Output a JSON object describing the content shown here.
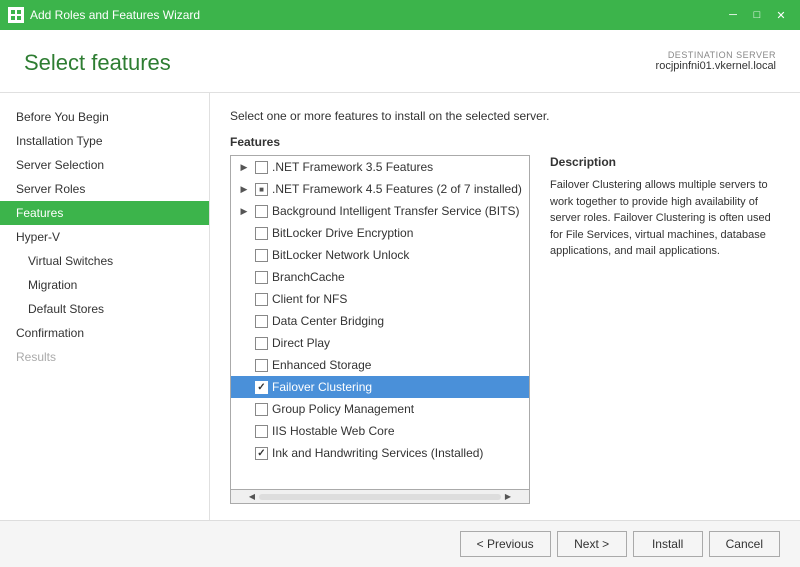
{
  "titleBar": {
    "title": "Add Roles and Features Wizard",
    "icon": "wizard-icon"
  },
  "header": {
    "pageTitle": "Select features",
    "destinationLabel": "DESTINATION SERVER",
    "serverName": "rocjpinfni01.vkernel.local"
  },
  "sidebar": {
    "items": [
      {
        "id": "before-you-begin",
        "label": "Before You Begin",
        "indent": 0,
        "active": false,
        "disabled": false
      },
      {
        "id": "installation-type",
        "label": "Installation Type",
        "indent": 0,
        "active": false,
        "disabled": false
      },
      {
        "id": "server-selection",
        "label": "Server Selection",
        "indent": 0,
        "active": false,
        "disabled": false
      },
      {
        "id": "server-roles",
        "label": "Server Roles",
        "indent": 0,
        "active": false,
        "disabled": false
      },
      {
        "id": "features",
        "label": "Features",
        "indent": 0,
        "active": true,
        "disabled": false
      },
      {
        "id": "hyper-v",
        "label": "Hyper-V",
        "indent": 0,
        "active": false,
        "disabled": false
      },
      {
        "id": "virtual-switches",
        "label": "Virtual Switches",
        "indent": 1,
        "active": false,
        "disabled": false
      },
      {
        "id": "migration",
        "label": "Migration",
        "indent": 1,
        "active": false,
        "disabled": false
      },
      {
        "id": "default-stores",
        "label": "Default Stores",
        "indent": 1,
        "active": false,
        "disabled": false
      },
      {
        "id": "confirmation",
        "label": "Confirmation",
        "indent": 0,
        "active": false,
        "disabled": false
      },
      {
        "id": "results",
        "label": "Results",
        "indent": 0,
        "active": false,
        "disabled": true
      }
    ]
  },
  "mainPanel": {
    "instruction": "Select one or more features to install on the selected server.",
    "featuresLabel": "Features",
    "features": [
      {
        "id": "net35",
        "label": ".NET Framework 3.5 Features",
        "hasChildren": true,
        "checked": false,
        "partial": false,
        "selected": false
      },
      {
        "id": "net45",
        "label": ".NET Framework 4.5 Features (2 of 7 installed)",
        "hasChildren": true,
        "checked": false,
        "partial": true,
        "selected": false
      },
      {
        "id": "bits",
        "label": "Background Intelligent Transfer Service (BITS)",
        "hasChildren": true,
        "checked": false,
        "partial": false,
        "selected": false
      },
      {
        "id": "bitlocker",
        "label": "BitLocker Drive Encryption",
        "hasChildren": false,
        "checked": false,
        "partial": false,
        "selected": false
      },
      {
        "id": "bitlocker-unlock",
        "label": "BitLocker Network Unlock",
        "hasChildren": false,
        "checked": false,
        "partial": false,
        "selected": false
      },
      {
        "id": "branchcache",
        "label": "BranchCache",
        "hasChildren": false,
        "checked": false,
        "partial": false,
        "selected": false
      },
      {
        "id": "client-nfs",
        "label": "Client for NFS",
        "hasChildren": false,
        "checked": false,
        "partial": false,
        "selected": false
      },
      {
        "id": "dcb",
        "label": "Data Center Bridging",
        "hasChildren": false,
        "checked": false,
        "partial": false,
        "selected": false
      },
      {
        "id": "direct-play",
        "label": "Direct Play",
        "hasChildren": false,
        "checked": false,
        "partial": false,
        "selected": false
      },
      {
        "id": "enhanced-storage",
        "label": "Enhanced Storage",
        "hasChildren": false,
        "checked": false,
        "partial": false,
        "selected": false
      },
      {
        "id": "failover-clustering",
        "label": "Failover Clustering",
        "hasChildren": false,
        "checked": true,
        "partial": false,
        "selected": true
      },
      {
        "id": "group-policy",
        "label": "Group Policy Management",
        "hasChildren": false,
        "checked": false,
        "partial": false,
        "selected": false
      },
      {
        "id": "iis-hostable",
        "label": "IIS Hostable Web Core",
        "hasChildren": false,
        "checked": false,
        "partial": false,
        "selected": false
      },
      {
        "id": "ink-handwriting",
        "label": "Ink and Handwriting Services (Installed)",
        "hasChildren": false,
        "checked": true,
        "partial": false,
        "selected": false
      }
    ]
  },
  "description": {
    "title": "Description",
    "text": "Failover Clustering allows multiple servers to work together to provide high availability of server roles. Failover Clustering is often used for File Services, virtual machines, database applications, and mail applications."
  },
  "footer": {
    "previousLabel": "< Previous",
    "nextLabel": "Next >",
    "installLabel": "Install",
    "cancelLabel": "Cancel"
  }
}
